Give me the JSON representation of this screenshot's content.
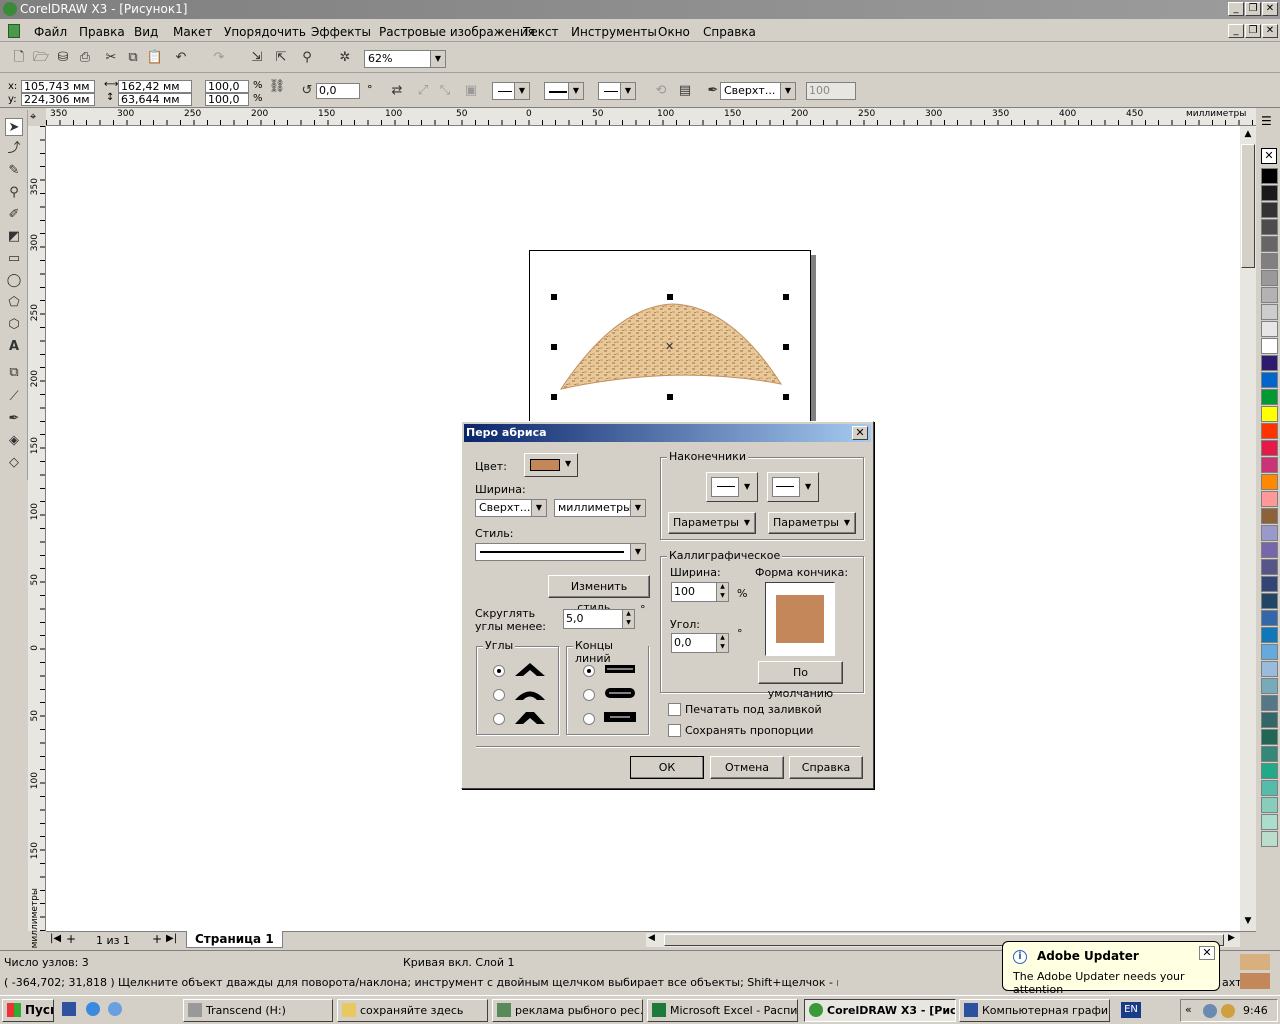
{
  "window": {
    "title": "CorelDRAW X3 - [Рисунок1]"
  },
  "menu": [
    "Файл",
    "Правка",
    "Вид",
    "Макет",
    "Упорядочить",
    "Эффекты",
    "Растровые изображения",
    "Текст",
    "Инструменты",
    "Окно",
    "Справка"
  ],
  "toolbar": {
    "zoom": "62%"
  },
  "propbar": {
    "x": "105,743 мм",
    "y": "224,306 мм",
    "w": "162,42 мм",
    "h": "63,644 мм",
    "scale_x": "100,0",
    "scale_y": "100,0",
    "pct1": "%",
    "pct2": "%",
    "angle": "0,0",
    "deg": "°",
    "outline": "Сверхт...",
    "opacity": "100"
  },
  "ruler": {
    "h_labels": [
      "350",
      "300",
      "250",
      "200",
      "150",
      "100",
      "50",
      "0",
      "50",
      "100",
      "150",
      "200",
      "250",
      "300",
      "350",
      "400",
      "450"
    ],
    "units": "миллиметры",
    "v_labels": [
      "350",
      "300",
      "250",
      "200",
      "150",
      "100",
      "50",
      "0",
      "50",
      "100",
      "150"
    ],
    "v_units": "миллиметры"
  },
  "dialog": {
    "title": "Перо абриса",
    "color_label": "Цвет:",
    "width_label": "Ширина:",
    "width_value": "Сверхт...",
    "units_value": "миллиметры",
    "style_label": "Стиль:",
    "edit_style": "Изменить стиль...",
    "round_corners_label1": "Скруглять",
    "round_corners_label2": "углы менее:",
    "round_corners_value": "5,0",
    "round_corners_deg": "°",
    "corners_legend": "Углы",
    "line_caps_legend": "Концы линий",
    "arrows_legend": "Наконечники",
    "arrow_params1": "Параметры",
    "arrow_params2": "Параметры",
    "calligraphy_legend": "Каллиграфическое",
    "cal_width_label": "Ширина:",
    "cal_width_value": "100",
    "cal_width_pct": "%",
    "nib_shape_label": "Форма кончика:",
    "angle_label": "Угол:",
    "angle_value": "0,0",
    "angle_deg": "°",
    "default_button": "По умолчанию",
    "behind_fill": "Печатать под заливкой",
    "scale_with_image": "Сохранять пропорции",
    "ok": "ОК",
    "cancel": "Отмена",
    "help": "Справка",
    "outline_color": "#c4875a"
  },
  "pagebar": {
    "counter": "1 из 1",
    "tab": "Страница 1"
  },
  "status": {
    "nodes": "Число узлов: 3",
    "object": "Кривая вкл. Слой 1",
    "coords": "( -364,702; 31,818 )",
    "hint": "Щелкните объект дважды для поворота/наклона; инструмент с двойным щелчком выбирает все объекты; Shift+щелчок - выбор нескол..."
  },
  "balloon": {
    "title": "Adobe Updater",
    "text": "The Adobe Updater needs your attention"
  },
  "taskbar": {
    "start": "Пуск",
    "tasks": [
      "Transcend (H:)",
      "сохраняйте здесь",
      "реклама рыбного рес...",
      "Microsoft Excel - Распи...",
      "CorelDRAW X3 - [Рис...",
      "Компьютерная графи..."
    ],
    "lang": "EN",
    "time": "9:46",
    "behind_text": "ахта..."
  },
  "palette_colors": [
    "#000000",
    "#1a1a1a",
    "#333333",
    "#4d4d4d",
    "#666666",
    "#808080",
    "#999999",
    "#b3b3b3",
    "#cccccc",
    "#e6e6e6",
    "#ffffff",
    "#2e1a6e",
    "#0066cc",
    "#009933",
    "#ffff00",
    "#ff3300",
    "#e6194b",
    "#cc3377",
    "#ff8800",
    "#ff9999",
    "#8c6239",
    "#9999cc",
    "#7766aa",
    "#555588",
    "#334477",
    "#224466",
    "#3366aa",
    "#1177bb",
    "#66aadd",
    "#99bbdd",
    "#77aabb",
    "#557788",
    "#336666",
    "#226655",
    "#338877",
    "#22aa88",
    "#55bbaa",
    "#88ccbb",
    "#aaddcc",
    "#bbddcc"
  ]
}
